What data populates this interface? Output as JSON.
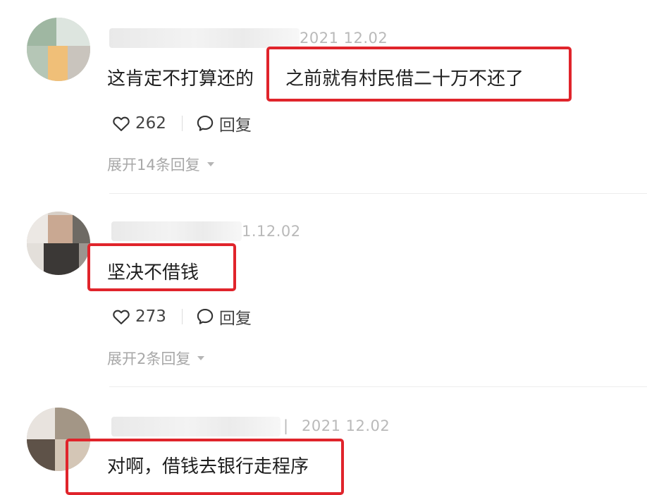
{
  "comments": [
    {
      "date": "2021 12.02",
      "text_plain": "这肯定不打算还的",
      "text_highlight": "之前就有村民借二十万不还了",
      "likes": "262",
      "reply_label": "回复",
      "expand_label": "展开14条回复"
    },
    {
      "date": "1.12.02",
      "text_highlight": "坚决不借钱",
      "likes": "273",
      "reply_label": "回复",
      "expand_label": "展开2条回复"
    },
    {
      "date": "2021 12.02",
      "date_prefix": "|",
      "text_highlight": "对啊，借钱去银行走程序"
    }
  ],
  "icons": {
    "like": "heart-icon",
    "reply": "speech-bubble-icon",
    "expand": "caret-down-icon"
  },
  "colors": {
    "highlight": "#e0242b",
    "date": "#b9b9b9",
    "muted": "#a8a8a8"
  }
}
